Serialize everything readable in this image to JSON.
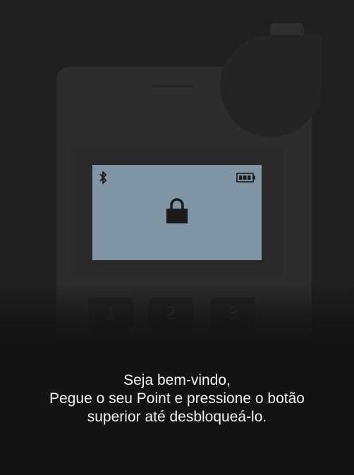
{
  "device": {
    "keys": [
      "1",
      "2",
      "3"
    ],
    "icons": {
      "bluetooth": "bluetooth-icon",
      "battery": "battery-icon",
      "lock": "lock-icon"
    },
    "lcd_color": "#7f95a6"
  },
  "message": {
    "line1": "Seja bem-vindo,",
    "line2": "Pegue o seu Point e pressione o botão",
    "line3": "superior até desbloqueá-lo."
  }
}
